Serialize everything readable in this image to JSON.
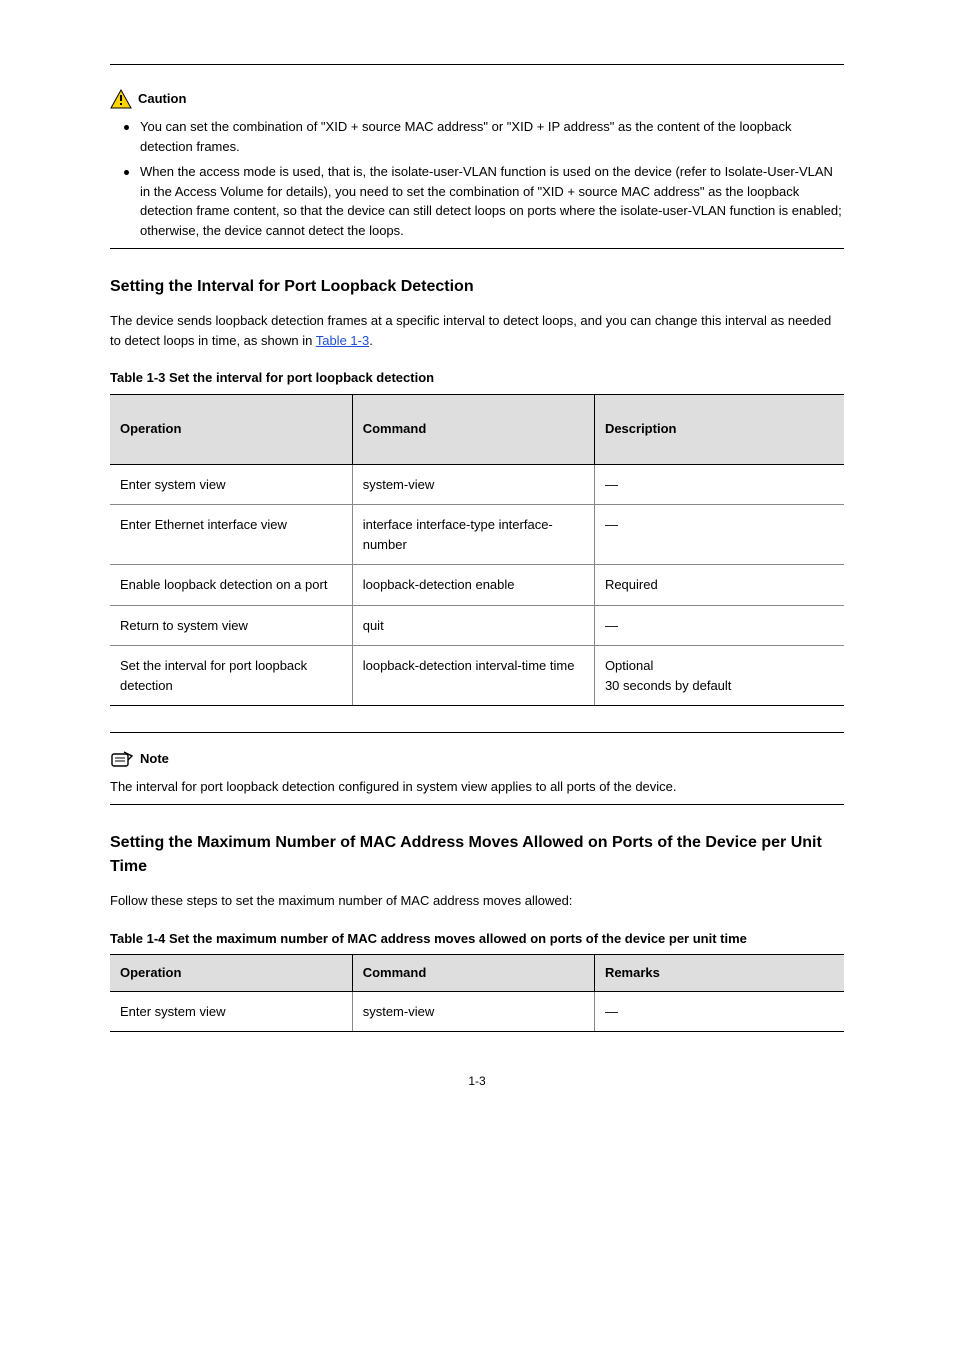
{
  "callout_caution": {
    "title": "Caution",
    "items": [
      "You can set the combination of \"XID + source MAC address\" or \"XID + IP address\" as the content of the loopback detection frames.",
      "When the access mode is used, that is, the isolate-user-VLAN function is used on the device (refer to Isolate-User-VLAN in the Access Volume for details), you need to set the combination of \"XID + source MAC address\" as the loopback detection frame content, so that the device can still detect loops on ports where the isolate-user-VLAN function is enabled; otherwise, the device cannot detect the loops."
    ]
  },
  "section1": {
    "title": "Setting the Interval for Port Loopback Detection",
    "intro": "The device sends loopback detection frames at a specific interval to detect loops, and you can change this interval as needed to detect loops in time, as shown in ",
    "intro_link": "Table 1-3",
    "intro_tail": "."
  },
  "table1": {
    "caption": "Table 1-3 Set the interval for port loopback detection",
    "headers": [
      "Operation",
      "Command",
      "Description"
    ],
    "rows": [
      [
        "Enter system view",
        "system-view",
        "—"
      ],
      [
        "Enter Ethernet interface view",
        "interface interface-type interface-number",
        "—"
      ],
      [
        "Enable loopback detection on a port",
        "loopback-detection enable",
        "Required"
      ],
      [
        "Return to system view",
        "quit",
        "—"
      ],
      [
        "Set the interval for port loopback detection",
        "loopback-detection interval-time time",
        "Optional\n30 seconds by default"
      ]
    ]
  },
  "callout_note": {
    "title": "Note",
    "body": "The interval for port loopback detection configured in system view applies to all ports of the device."
  },
  "section2": {
    "title": "Setting the Maximum Number of MAC Address Moves Allowed on Ports of the Device per Unit Time",
    "intro": "Follow these steps to set the maximum number of MAC address moves allowed:"
  },
  "table2": {
    "caption": "Table 1-4 Set the maximum number of MAC address moves allowed on ports of the device per unit time",
    "headers": [
      "Operation",
      "Command",
      "Remarks"
    ],
    "rows": [
      [
        "Enter system view",
        "system-view",
        "—"
      ]
    ]
  },
  "page_number": "1-3"
}
